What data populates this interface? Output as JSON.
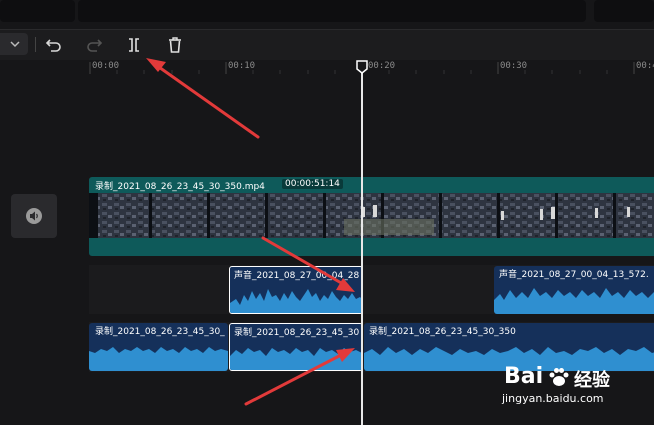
{
  "ruler": {
    "ticks": [
      "00:00",
      "00:10",
      "00:20",
      "00:30",
      "00:40"
    ]
  },
  "video_track": {
    "clip_name": "录制_2021_08_26_23_45_30_350.mp4",
    "clip_duration": "00:00:51:14"
  },
  "audio_track_1": {
    "clips": [
      {
        "label": "声音_2021_08_27_00_04_28"
      },
      {
        "label": "声音_2021_08_27_00_04_13_572."
      }
    ]
  },
  "audio_track_2": {
    "clips": [
      {
        "label": "录制_2021_08_26_23_45_30_"
      },
      {
        "label": "录制_2021_08_26_23_45_30"
      },
      {
        "label": "录制_2021_08_26_23_45_30_350"
      }
    ]
  },
  "watermark": {
    "brand": "Bai",
    "brand2": "经验",
    "url": "jingyan.baidu.com"
  },
  "colors": {
    "video_clip": "#0e5a5a",
    "audio_clip": "#15305a",
    "waveform": "#2f8fd0",
    "annotation": "#e23a3a",
    "playhead": "#e8e8e8"
  },
  "icons": [
    "chevron-down-icon",
    "undo-icon",
    "redo-icon",
    "split-icon",
    "delete-icon",
    "speaker-icon"
  ]
}
